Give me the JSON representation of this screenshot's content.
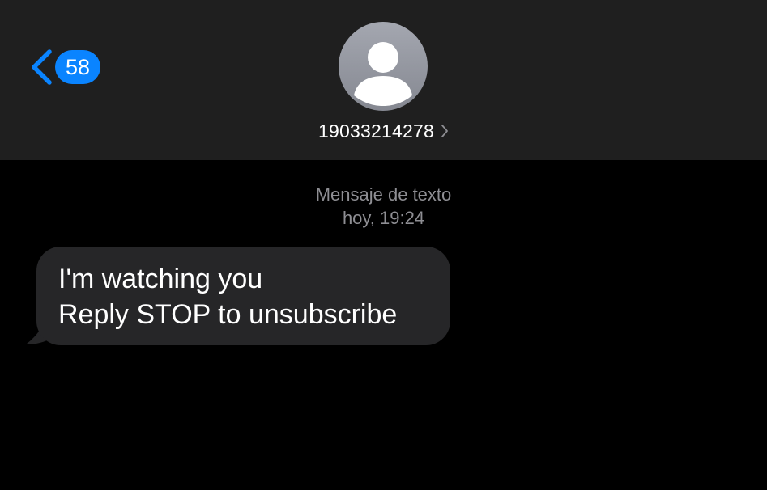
{
  "header": {
    "back_icon": "chevron-left-icon",
    "unread_count": "58",
    "avatar_icon": "person-silhouette-icon",
    "contact_name": "19033214278",
    "contact_chevron_icon": "chevron-right-icon"
  },
  "conversation": {
    "message_type": "Mensaje de texto",
    "timestamp": "hoy, 19:24",
    "messages": [
      {
        "direction": "incoming",
        "lines": [
          "I'm watching you",
          "Reply STOP to unsubscribe"
        ]
      }
    ]
  },
  "colors": {
    "header_background": "#1f1f1f",
    "screen_background": "#000000",
    "accent_blue": "#0a84ff",
    "incoming_bubble": "#262628",
    "meta_text": "#8e8e93",
    "avatar_gray": "#9a9ca4"
  }
}
